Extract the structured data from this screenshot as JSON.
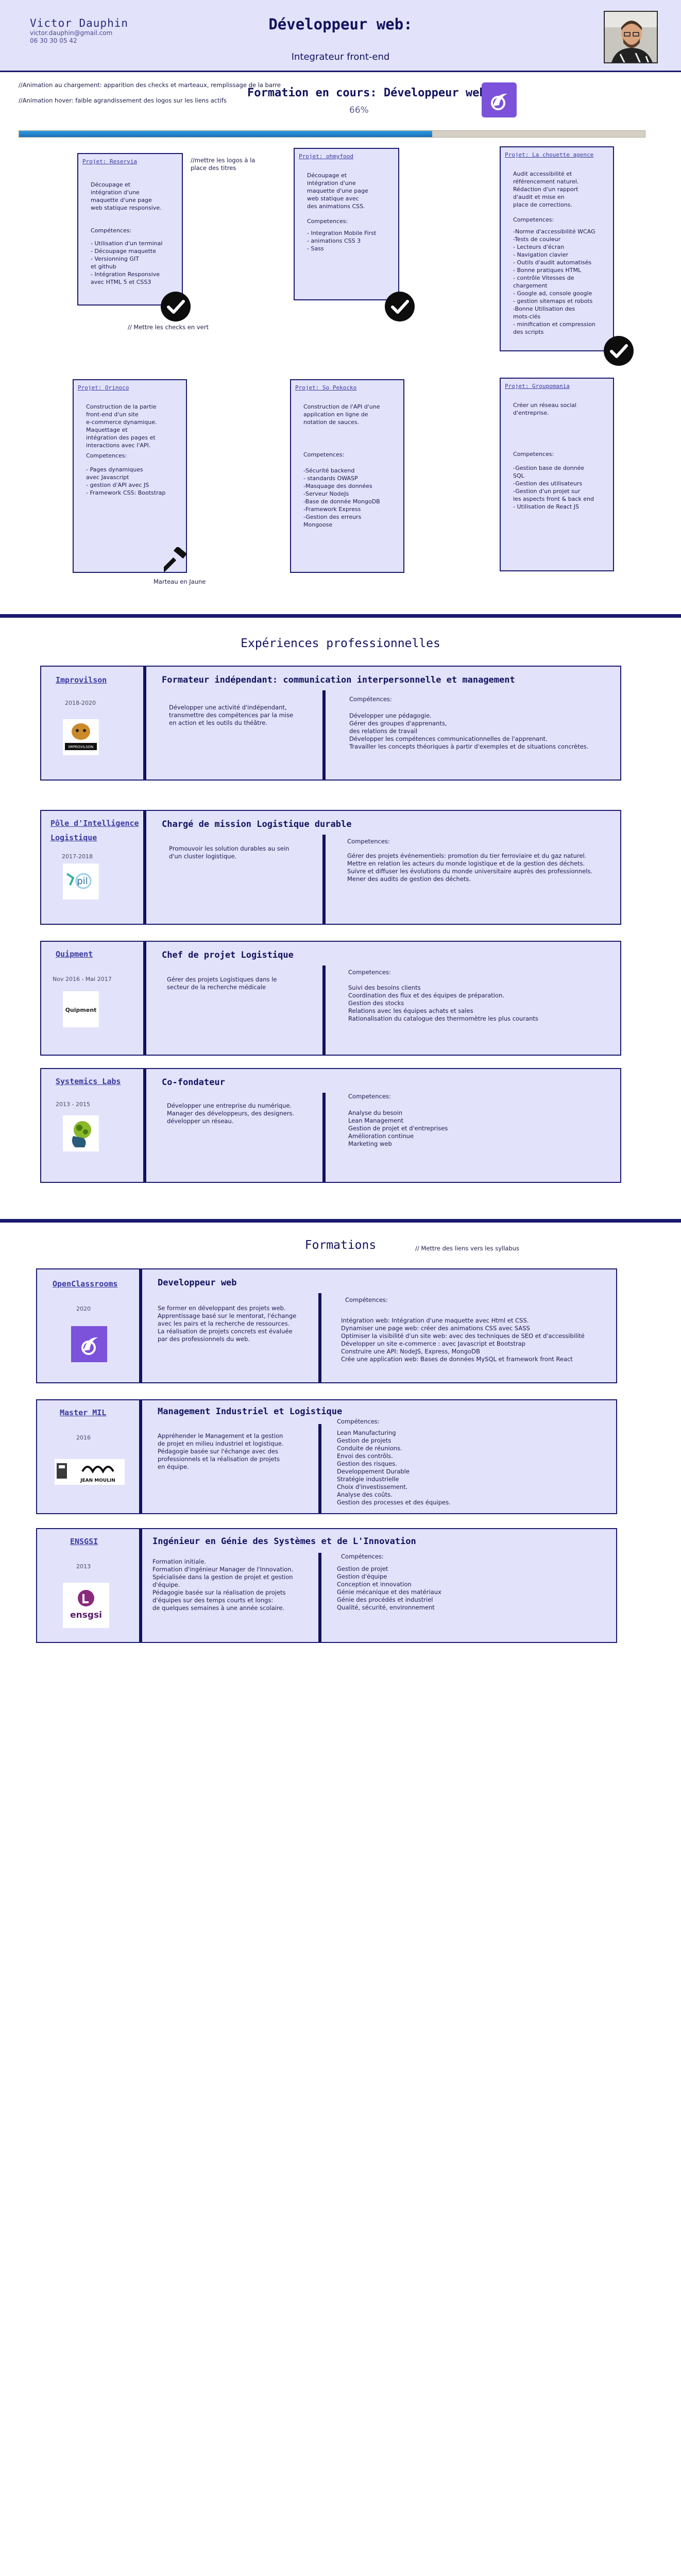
{
  "header": {
    "name": "Victor Dauphin",
    "email": "victor.dauphin@gmail.com",
    "phone": "06 30 30 05 42",
    "title": "Développeur web:",
    "subtitle": "Integrateur front-end"
  },
  "notes": {
    "animation_load": "//Animation au chargement: apparition des checks et marteaux, remplissage de la barre",
    "animation_hover": "//Animation hover: faible agrandissement des logos sur les liens actifs",
    "logos_links": "//mettre les logos à la place des titres",
    "checks_green": "// Mettre les checks en vert",
    "hammer_yellow": "Marteau en Jaune",
    "links_syllabus": "// Mettre des liens vers les syllabus"
  },
  "training": {
    "title": "Formation en cours: Développeur web",
    "progress_label": "66%",
    "progress": 0.66
  },
  "projects": [
    {
      "title": "Projet: Reservia",
      "description": "Découpage et\nintégration d'une\nmaquette d'une page\nweb statique responsive.",
      "skills_label": "Compétences:",
      "skills": "- Utilisation d'un terminal\n- Découpage maquette\n- Versionning GIT\net github\n- Intégration Responsive\navec HTML 5 et CSS3",
      "status": "done"
    },
    {
      "title": "Projet: ohmyfood",
      "description": "Découpage et\nintégration d'une\nmaquette d'une page\nweb statique avec\ndes animations CSS.",
      "skills_label": "Competences:",
      "skills": "- Integration Mobile First\n- animations CSS 3\n- Sass",
      "status": "done"
    },
    {
      "title": "Projet: La chouette agence",
      "description": "Audit accessibilité et\nréférencement naturel.\nRédaction d'un rapport\nd'audit et mise en\nplace de corrections.",
      "skills_label": "Competences:",
      "skills": "-Norme d'accessibilité WCAG\n-Tests de couleur\n- Lecteurs d'écran\n- Navigation clavier\n- Outils d'audit automatisés\n- Bonne pratiques HTML\n- contrôle Vitesses de\nchargement\n- Google ad, console google\n- gestion sitemaps et robots\n-Bonne Utilisation des\nmots-clés\n- minification et compression\ndes scripts",
      "status": "done"
    },
    {
      "title": "Projet: Orinoco",
      "description": "Construction de la partie\nfront-end d'un site\ne-commerce dynamique.\nMaquettage et\nintégration des pages et\ninteractions avec l'API.",
      "skills_label": "Competences:",
      "skills": "- Pages dynamiques\navec Javascript\n- gestion d'API avec JS\n- Framework CSS: Bootstrap",
      "status": "in-progress"
    },
    {
      "title": "Projet: So Pekocko",
      "description": "Construction de l'API d'une\napplication en ligne de\nnotation de sauces.",
      "skills_label": "Competences:",
      "skills": "-Sécurité backend\n- standards OWASP\n-Masquage des données\n-Serveur NodeJs\n-Base de donnée MongoDB\n-Framework Express\n-Gestion des erreurs\nMongoose",
      "status": "todo"
    },
    {
      "title": "Projet: Groupomania",
      "description": "Créer un réseau social\nd'entreprise.",
      "skills_label": "Competences:",
      "skills": "-Gestion base de donnée\nSQL\n-Gestion des utilisateurs\n-Gestion d'un projet sur\nles aspects front & back end\n- Utilisation de React JS",
      "status": "todo"
    }
  ],
  "experiences_title": "Expériences professionnelles",
  "experiences": [
    {
      "company": "Improvilson",
      "years": "2018-2020",
      "logo_text": "IMPROVILSON",
      "role": "Formateur indépendant: communication interpersonnelle et management",
      "description": "Développer une activité d'indépendant,\ntransmettre des compétences par la mise\nen action et les outils du théâtre.",
      "skills_label": "Compétences:",
      "skills": "Développer une pédagogie.\nGérer des groupes d'apprenants,\ndes relations de travail\nDévelopper les compétences communicationnelles de l'apprenant.\nTravailler les concepts théoriques à partir d'exemples et de situations concrètes."
    },
    {
      "company": "Pôle d'Intelligence Logistique",
      "years": "2017-2018",
      "logo_text": "pil",
      "role": "Chargé de mission Logistique durable",
      "description": "Promouvoir les solution durables au sein\nd'un cluster logistique.",
      "skills_label": "Competences:",
      "skills": "Gérer des projets événementiels: promotion du tier ferroviaire et du gaz naturel.\nMettre en relation les acteurs du monde logistique et de la gestion des déchets.\nSuivre et diffuser les évolutions du monde universitaire auprès des professionnels.\nMener des audits de gestion des déchets."
    },
    {
      "company": "Quipment",
      "years": "Nov 2016 - Mai 2017",
      "logo_text": "Quipment",
      "role": "Chef de projet Logistique",
      "description": "Gérer des projets Logistiques dans le\nsecteur de la recherche médicale",
      "skills_label": "Competences:",
      "skills": "Suivi des besoins clients\nCoordination des flux et des équipes de préparation.\nGestion des stocks\nRelations avec les équipes achats et sales\nRationalisation du catalogue des thermomètre les plus courants"
    },
    {
      "company": "Systemics Labs",
      "years": "2013 - 2015",
      "logo_text": "",
      "role": "Co-fondateur",
      "description": "Développer une entreprise du numérique.\nManager des développeurs, des designers.\ndévelopper un réseau.",
      "skills_label": "Competences:",
      "skills": "Analyse du besoin\nLean Management\nGestion de projet et d'entreprises\nAmélioration continue\nMarketing web"
    }
  ],
  "formations_title": "Formations",
  "formations": [
    {
      "school": "OpenClassrooms",
      "years": "2020",
      "logo_text": "",
      "role": "Developpeur web",
      "description": "Se former en développant des projets web.\nApprentissage basé sur le mentorat, l'échange\navec les pairs et la recherche de ressources.\nLa réalisation de projets concrets est évaluée\npar des professionnels du web.",
      "skills_label": "Compétences:",
      "skills": "Intégration web: Intégration d'une maquette avec Html et CSS.\nDynamiser une page web: créer des animations CSS avec SASS\nOptimiser la visibilité d'un site web: avec des techniques de SEO et d'accessibilité\nDévelopper un site e-commerce : avec Javascript et Bootstrap\nConstruire une API: NodeJS, Express, MongoDB\nCrée une application web: Bases de données MySQL et framework front React"
    },
    {
      "school": "Master MIL",
      "years": "2016",
      "logo_text": "JEAN MOULIN",
      "role": "Management Industriel et Logistique",
      "description": "Appréhender le Management et la gestion\nde projet en milieu industriel et logistique.\nPédagogie basée sur l'échange avec des\nprofessionnels et la réalisation de projets\nen équipe.",
      "skills_label": "Compétences:",
      "skills": "Lean Manufacturing\nGestion de projets\nConduite de réunions.\nEnvoi des contrôls.\nGestion des risques.\nDeveloppement Durable\nStratégie industrielle\nChoix d'investissement.\nAnalyse des coûts.\nGestion des processes et des équipes."
    },
    {
      "school": "ENSGSI",
      "years": "2013",
      "logo_text": "ensgsi",
      "role": "Ingénieur en Génie des Systèmes et de L'Innovation",
      "description": "Formation initiale.\nFormation d'ingénieur Manager de l'Innovation.\nSpécialisée dans la gestion de projet et gestion\nd'équipe.\nPédagogie basée sur la réalisation de projets\nd'équipes sur des temps courts et longs:\nde quelques semaines à une année scolaire.",
      "skills_label": "Compétences:",
      "skills": "Gestion de projet\nGestion d'équipe\nConception et innovation\nGénie mécanique et des matériaux\nGénie des procédés et industriel\nQualité, sécurité, environnement"
    }
  ]
}
